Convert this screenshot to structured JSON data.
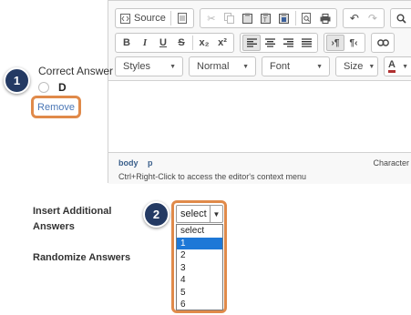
{
  "editor": {
    "toolbar_row1": {
      "source_label": "Source",
      "icons": [
        "source-icon",
        "document-icon",
        "cut-icon",
        "copy-icon",
        "paste-icon",
        "paste-text-icon",
        "paste-word-icon",
        "preview-icon",
        "print-icon",
        "undo-icon",
        "redo-icon",
        "find-icon"
      ]
    },
    "toolbar_row2": {
      "bold": "B",
      "italic": "I",
      "underline": "U",
      "strike": "S",
      "subscript": "x₂",
      "superscript": "x²",
      "icons": [
        "align-left-icon",
        "align-center-icon",
        "align-right-icon",
        "justify-icon",
        "ltr-icon",
        "rtl-icon",
        "link-icon"
      ]
    },
    "toolbar_row3": {
      "styles": "Styles",
      "format": "Normal",
      "font": "Font",
      "size": "Size",
      "text_color": "A"
    },
    "status": {
      "path_body": "body",
      "path_p": "p",
      "char_label": "Character",
      "hint": "Ctrl+Right-Click to access the editor's context menu"
    }
  },
  "answer": {
    "correct_label": "Correct Answer",
    "option_letter": "D",
    "remove_label": "Remove"
  },
  "callouts": {
    "step1": "1",
    "step2": "2"
  },
  "form": {
    "insert_additional_label": "Insert Additional Answers",
    "randomize_label": "Randomize Answers",
    "select_value": "select",
    "options": [
      "select",
      "1",
      "2",
      "3",
      "4",
      "5",
      "6"
    ],
    "highlighted_option": "1"
  },
  "colors": {
    "callout_badge": "#243a63",
    "highlight_outline": "#e08a4a",
    "link": "#4a76b5",
    "selected_option": "#1e78d7"
  }
}
